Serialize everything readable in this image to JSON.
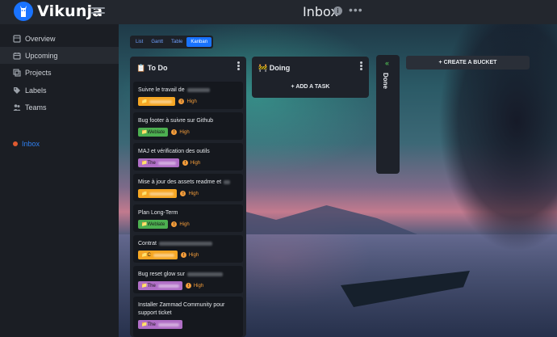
{
  "app": {
    "brand": "Vikunja",
    "page_title": "Inbox"
  },
  "sidebar": {
    "items": [
      {
        "label": "Overview",
        "icon": "overview-icon",
        "active": false
      },
      {
        "label": "Upcoming",
        "icon": "calendar-icon",
        "active": true
      },
      {
        "label": "Projects",
        "icon": "layers-icon",
        "active": false
      },
      {
        "label": "Labels",
        "icon": "tags-icon",
        "active": false
      },
      {
        "label": "Teams",
        "icon": "users-icon",
        "active": false
      }
    ],
    "project": {
      "label": "Inbox",
      "dot_color": "#e05a30"
    }
  },
  "views": [
    {
      "label": "List",
      "active": false
    },
    {
      "label": "Gantt",
      "active": false
    },
    {
      "label": "Table",
      "active": false
    },
    {
      "label": "Kanban",
      "active": true
    }
  ],
  "buckets": {
    "todo": {
      "title": "📋 To Do",
      "cards": [
        {
          "title": "Suivre le travail de",
          "label": "",
          "label_color": "#f5a623",
          "priority": "High"
        },
        {
          "title": "Bug footer à suivre sur Github",
          "label": "Weblate",
          "label_color": "#4caf50",
          "priority": "High"
        },
        {
          "title": "MAJ et vérification des outils",
          "label": "The",
          "label_color": "#b06ec6",
          "priority": "High"
        },
        {
          "title": "Mise à jour des assets readme et",
          "label": "",
          "label_color": "#f5a623",
          "priority": "High"
        },
        {
          "title": "Plan Long-Term",
          "label": "Weblate",
          "label_color": "#4caf50",
          "priority": "High"
        },
        {
          "title": "Contrat",
          "label": "C",
          "label_color": "#f5a623",
          "priority": "High"
        },
        {
          "title": "Bug reset glow sur",
          "label": "The",
          "label_color": "#b06ec6",
          "priority": "High"
        },
        {
          "title": "Installer Zammad Community pour support ticket",
          "label": "The",
          "label_color": "#b06ec6",
          "priority": ""
        }
      ]
    },
    "doing": {
      "title": "🚧 Doing",
      "add_task": "+ ADD A TASK"
    },
    "done": {
      "title": "Done",
      "chevron": "«"
    },
    "create_bucket": "+ CREATE A BUCKET"
  },
  "colors": {
    "accent": "#1973ff",
    "priority": "#f39c3a"
  }
}
